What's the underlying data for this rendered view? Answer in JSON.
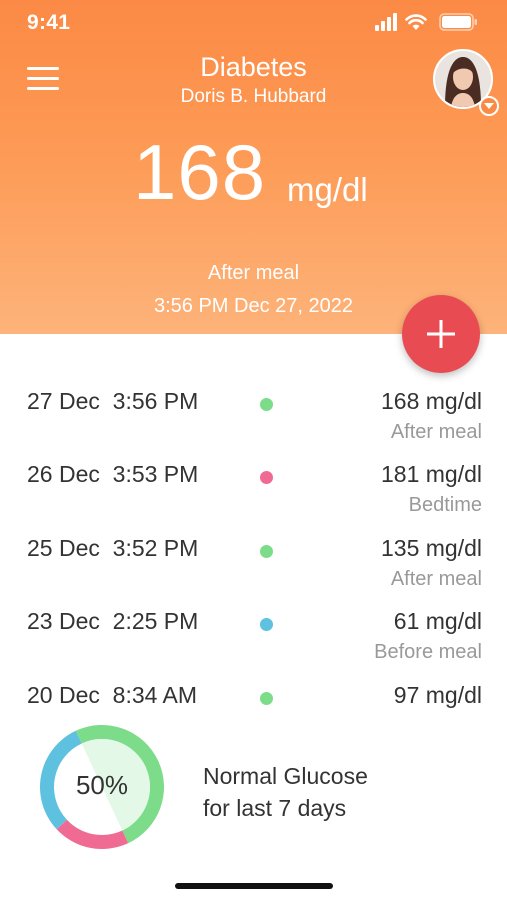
{
  "status": {
    "time": "9:41"
  },
  "header": {
    "title": "Diabetes",
    "user_name": "Doris B. Hubbard",
    "glucose_value": "168",
    "glucose_unit": "mg/dl",
    "context": "After meal",
    "timestamp": "3:56 PM Dec 27, 2022"
  },
  "readings": [
    {
      "date": "27 Dec  3:56 PM",
      "value": "168 mg/dl",
      "context": "After meal",
      "status_color": "#7ddc8a"
    },
    {
      "date": "26 Dec  3:53 PM",
      "value": "181 mg/dl",
      "context": "Bedtime",
      "status_color": "#f06b93"
    },
    {
      "date": "25 Dec  3:52 PM",
      "value": "135 mg/dl",
      "context": "After meal",
      "status_color": "#7ddc8a"
    },
    {
      "date": "23 Dec  2:25 PM",
      "value": "61 mg/dl",
      "context": "Before meal",
      "status_color": "#5ec1e0"
    },
    {
      "date": "20 Dec  8:34 AM",
      "value": "97 mg/dl",
      "context": "",
      "status_color": "#7ddc8a"
    }
  ],
  "summary": {
    "percent": "50%",
    "line1": "Normal Glucose",
    "line2": "for last 7 days",
    "segments": [
      {
        "label": "normal",
        "fraction": 0.5,
        "color": "#7ddc8a"
      },
      {
        "label": "high",
        "fraction": 0.2,
        "color": "#f06b93"
      },
      {
        "label": "low",
        "fraction": 0.3,
        "color": "#5ec1e0"
      }
    ]
  },
  "colors": {
    "header_top": "#fb8a45",
    "header_bottom": "#fdb37a",
    "add_button": "#e84c52"
  },
  "icons": [
    "signal-icon",
    "wifi-icon",
    "battery-icon",
    "menu-icon",
    "chevron-down-icon",
    "plus-icon"
  ]
}
